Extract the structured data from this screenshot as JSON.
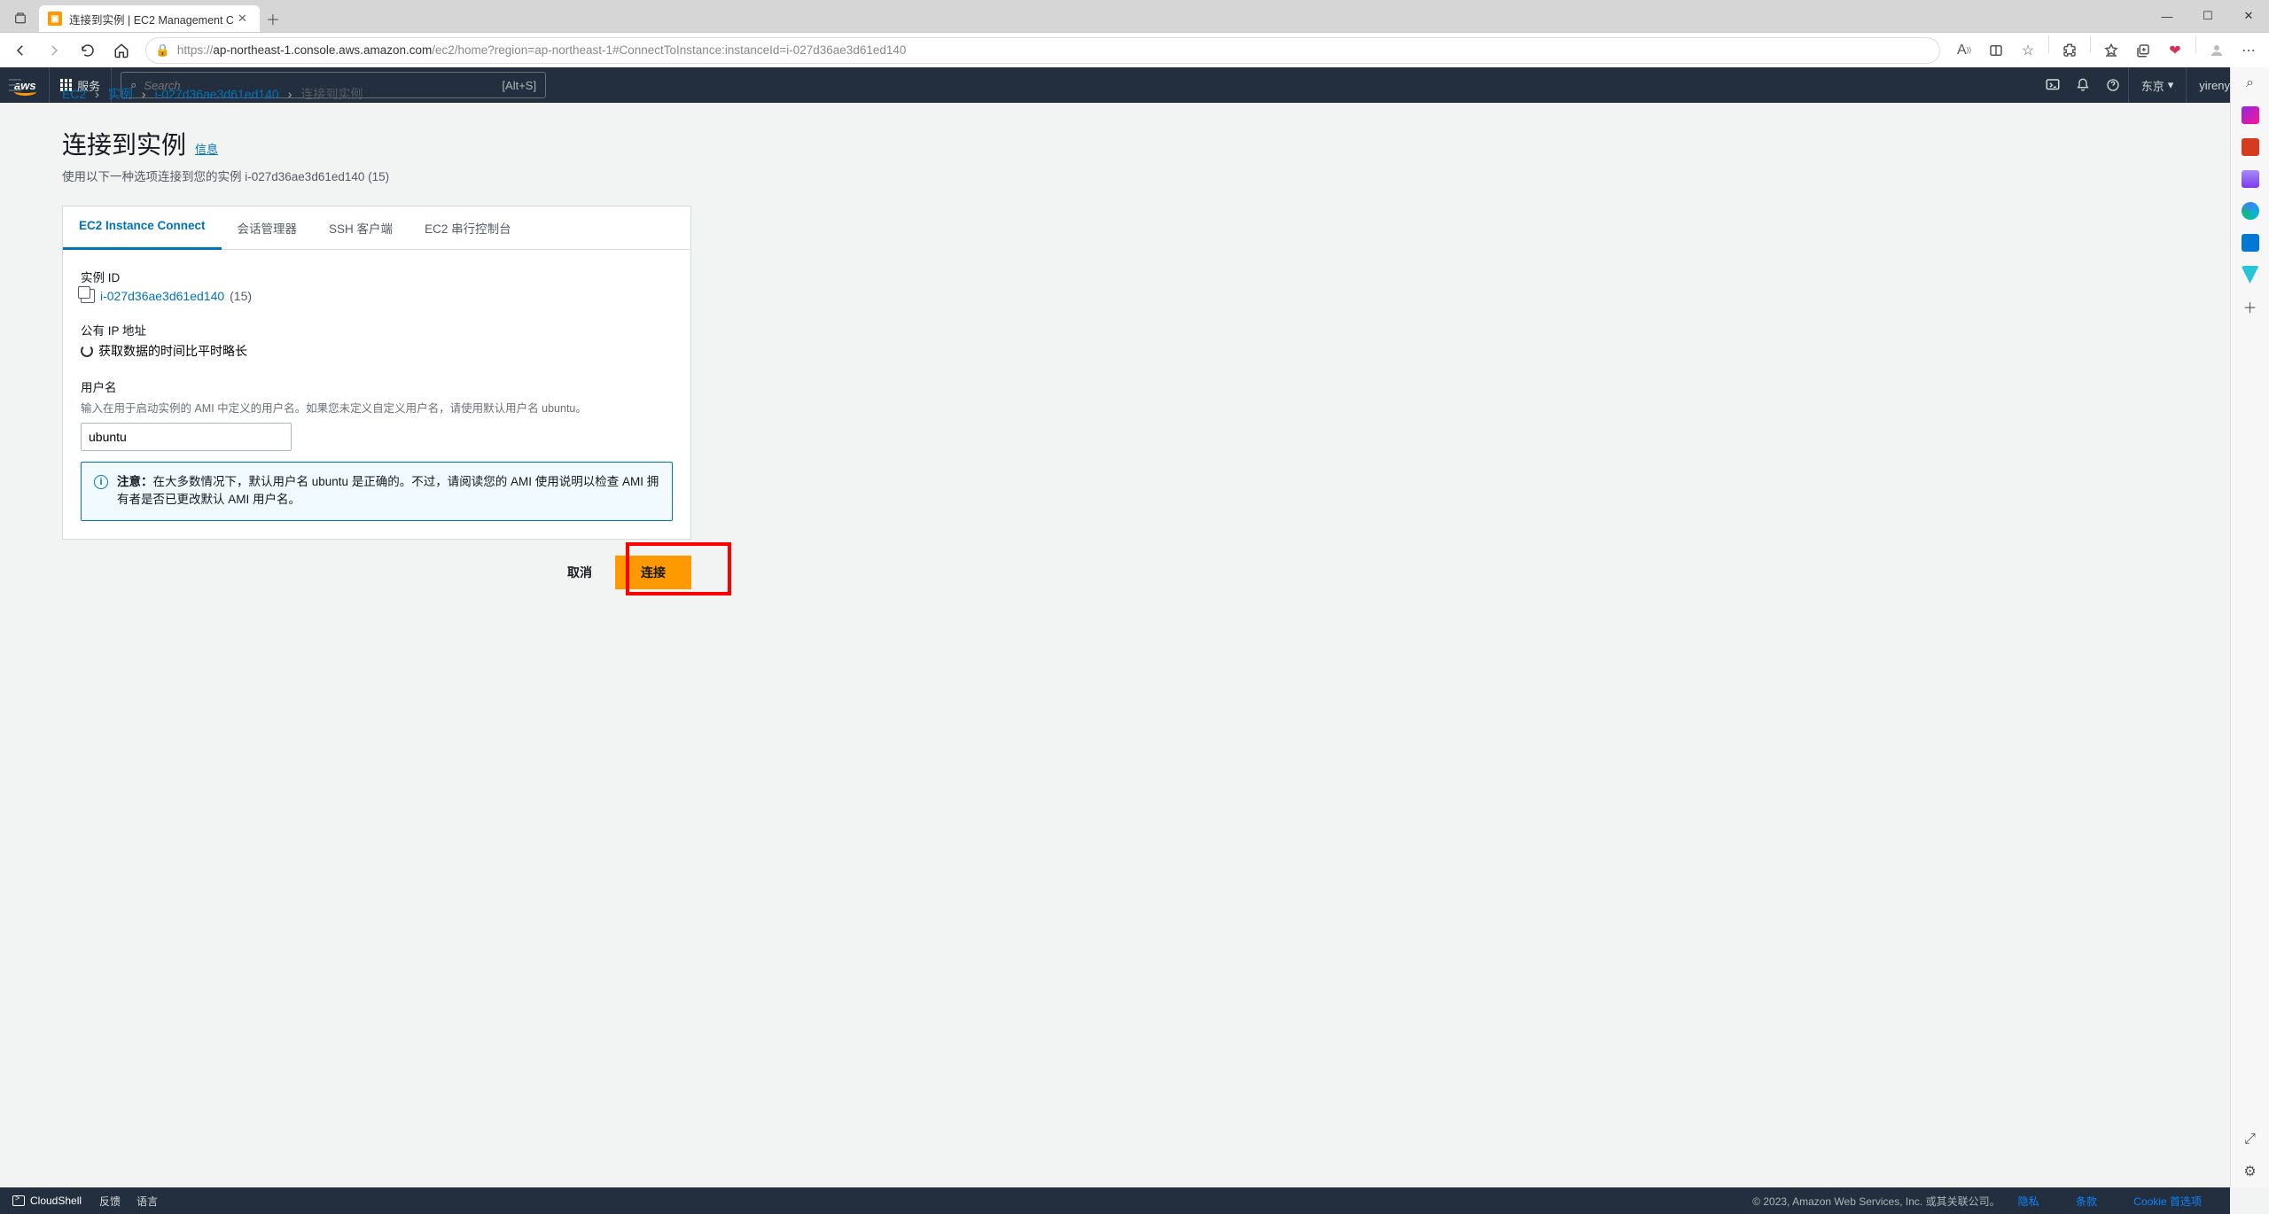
{
  "browser": {
    "tab_title": "连接到实例 | EC2 Management C",
    "url_prefix": "https://",
    "url_host": "ap-northeast-1.console.aws.amazon.com",
    "url_path": "/ec2/home?region=ap-northeast-1#ConnectToInstance:instanceId=i-027d36ae3d61ed140"
  },
  "aws_header": {
    "logo": "aws",
    "services": "服务",
    "search_placeholder": "Search",
    "search_shortcut": "[Alt+S]",
    "region": "东京",
    "user": "yirenyixin"
  },
  "breadcrumb": [
    {
      "label": "EC2",
      "link": true
    },
    {
      "label": "实例",
      "link": true
    },
    {
      "label": "i-027d36ae3d61ed140",
      "link": true
    },
    {
      "label": "连接到实例",
      "link": false
    }
  ],
  "page": {
    "title": "连接到实例",
    "info": "信息",
    "subtitle": "使用以下一种选项连接到您的实例 i-027d36ae3d61ed140 (15)"
  },
  "tabs": [
    {
      "label": "EC2 Instance Connect",
      "active": true
    },
    {
      "label": "会话管理器",
      "active": false
    },
    {
      "label": "SSH 客户端",
      "active": false
    },
    {
      "label": "EC2 串行控制台",
      "active": false
    }
  ],
  "fields": {
    "instance_id_label": "实例 ID",
    "instance_id": "i-027d36ae3d61ed140",
    "instance_id_suffix": " (15)",
    "public_ip_label": "公有 IP 地址",
    "public_ip_loading": "获取数据的时间比平时略长",
    "username_label": "用户名",
    "username_desc": "输入在用于启动实例的 AMI 中定义的用户名。如果您未定义自定义用户名，请使用默认用户名 ubuntu。",
    "username_value": "ubuntu"
  },
  "alert": {
    "prefix": "注意：",
    "text": "在大多数情况下，默认用户名 ubuntu 是正确的。不过，请阅读您的 AMI 使用说明以检查 AMI 拥有者是否已更改默认 AMI 用户名。"
  },
  "actions": {
    "cancel": "取消",
    "connect": "连接"
  },
  "footer": {
    "cloudshell": "CloudShell",
    "feedback": "反馈",
    "language": "语言",
    "copyright": "© 2023, Amazon Web Services, Inc. 或其关联公司。",
    "privacy": "隐私",
    "terms": "条款",
    "cookie": "Cookie 首选项"
  }
}
